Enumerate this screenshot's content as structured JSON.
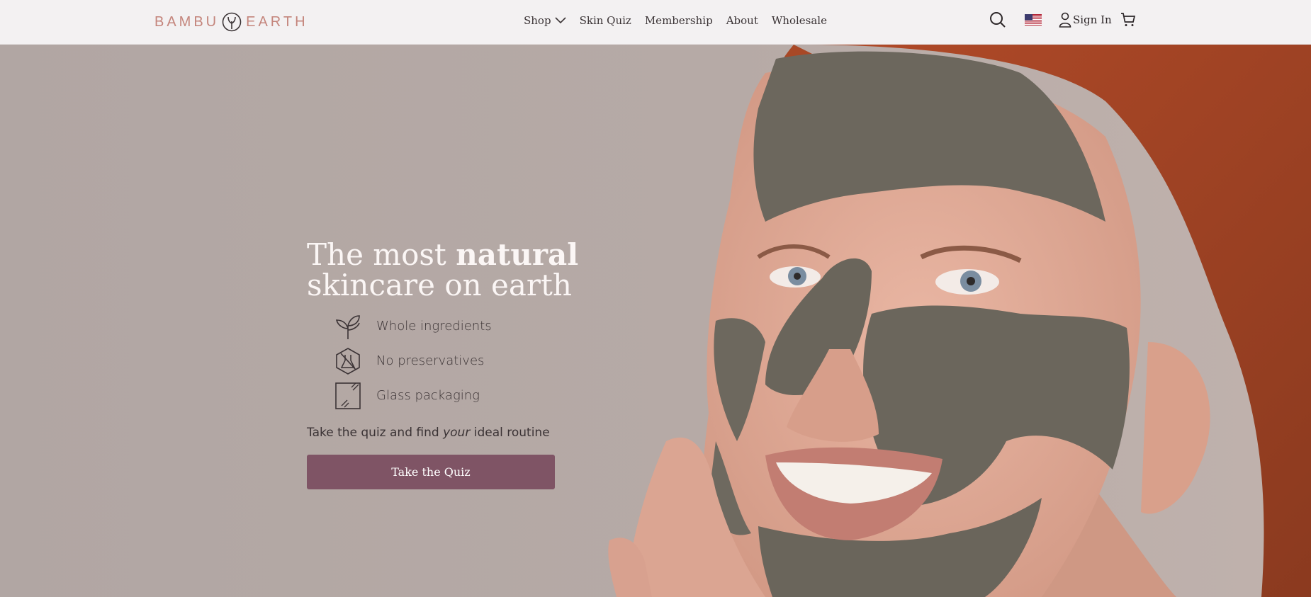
{
  "header": {
    "logo_left": "BAMBU",
    "logo_right": "EARTH",
    "nav": {
      "shop": "Shop",
      "skin_quiz": "Skin Quiz",
      "membership": "Membership",
      "about": "About",
      "wholesale": "Wholesale"
    },
    "sign_in": "Sign In",
    "icons": {
      "search": "search-icon",
      "flag": "us-flag-icon",
      "user": "user-icon",
      "cart": "cart-icon"
    }
  },
  "hero": {
    "headline_light": "The most",
    "headline_bold": "natural",
    "headline_line2": "skincare on earth",
    "features": [
      {
        "icon": "sprout-icon",
        "label": "Whole ingredients"
      },
      {
        "icon": "no-preservatives-icon",
        "label": "No preservatives"
      },
      {
        "icon": "glass-jar-icon",
        "label": "Glass packaging"
      }
    ],
    "tagline_before": "Take the quiz and find",
    "tagline_em": "your",
    "tagline_after": "ideal routine",
    "cta": "Take the Quiz"
  },
  "colors": {
    "brand": "#c4857c",
    "cta_bg": "#7f5465",
    "hero_bg": "#b2a7a4",
    "header_bg": "#f3f1f2"
  }
}
